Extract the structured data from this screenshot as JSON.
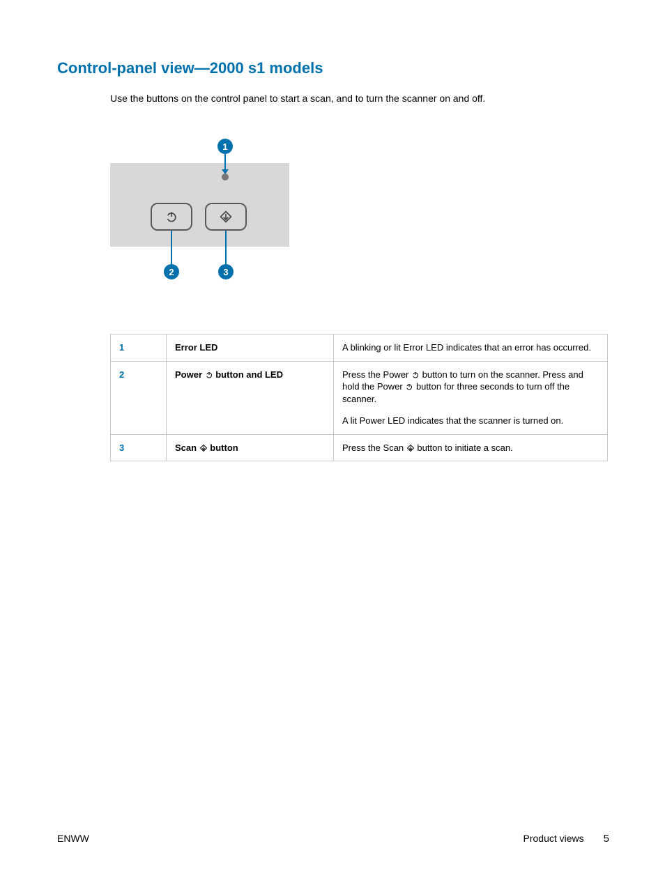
{
  "heading": "Control-panel view—2000 s1 models",
  "intro": "Use the buttons on the control panel to start a scan, and to turn the scanner on and off.",
  "callouts": {
    "c1": "1",
    "c2": "2",
    "c3": "3"
  },
  "table": {
    "rows": [
      {
        "num": "1",
        "name": "Error LED",
        "desc": "A blinking or lit Error LED indicates that an error has occurred."
      },
      {
        "num": "2",
        "name_pre": "Power ",
        "name_post": " button and LED",
        "desc_p1_pre": "Press the Power ",
        "desc_p1_mid": " button to turn on the scanner. Press and hold the Power ",
        "desc_p1_post": " button for three seconds to turn off the scanner.",
        "desc_p2": "A lit Power LED indicates that the scanner is turned on."
      },
      {
        "num": "3",
        "name_pre": "Scan ",
        "name_post": " button",
        "desc_pre": "Press the Scan ",
        "desc_post": " button to initiate a scan."
      }
    ]
  },
  "footer": {
    "left": "ENWW",
    "section": "Product views",
    "page": "5"
  }
}
